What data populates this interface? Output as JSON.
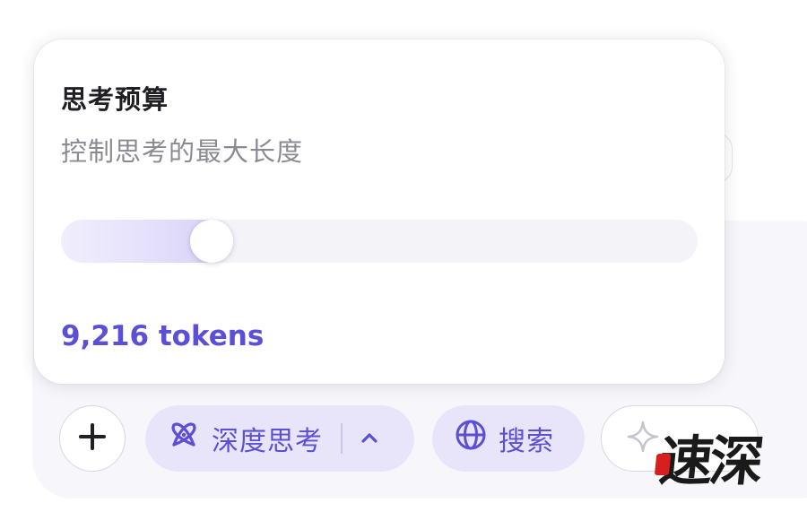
{
  "popover": {
    "title": "思考预算",
    "subtitle": "控制思考的最大长度",
    "slider": {
      "fraction": 0.237,
      "readout": "9,216 tokens"
    }
  },
  "toolbar": {
    "plus_icon": "plus-icon",
    "deep_think": {
      "label": "深度思考",
      "icon": "atom-icon",
      "chevron": "chevron-up-icon"
    },
    "search": {
      "label": "搜索",
      "icon": "globe-icon"
    },
    "ghost_icon": "sparkle-icon"
  },
  "watermark": "速深",
  "colors": {
    "accent": "#5b4fd6",
    "pill_bg": "#e8e5fb",
    "track": "#f3f3f8"
  }
}
